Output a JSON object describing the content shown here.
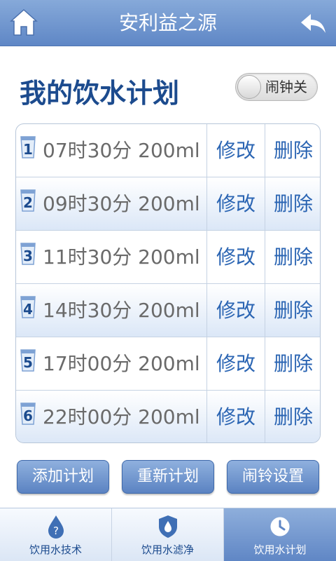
{
  "header": {
    "title": "安利益之源"
  },
  "plan": {
    "title": "我的饮水计划",
    "alarm_toggle_label": "闹钟关",
    "alarm_on": false,
    "edit_label": "修改",
    "delete_label": "删除",
    "rows": [
      {
        "index": "1",
        "time": "07时30分 200ml"
      },
      {
        "index": "2",
        "time": "09时30分 200ml"
      },
      {
        "index": "3",
        "time": "11时30分 200ml"
      },
      {
        "index": "4",
        "time": "14时30分 200ml"
      },
      {
        "index": "5",
        "time": "17时00分 200ml"
      },
      {
        "index": "6",
        "time": "22时00分 200ml"
      }
    ]
  },
  "actions": {
    "add": "添加计划",
    "reset": "重新计划",
    "ringtone": "闹铃设置"
  },
  "tabs": [
    {
      "label": "饮用水技术",
      "icon": "water-drop-question-icon"
    },
    {
      "label": "饮用水滤净",
      "icon": "shield-water-icon"
    },
    {
      "label": "饮用水计划",
      "icon": "clock-icon",
      "active": true
    }
  ],
  "colors": {
    "accent": "#2b65b3",
    "header": "#6f94cf",
    "title": "#1c4b8e"
  }
}
